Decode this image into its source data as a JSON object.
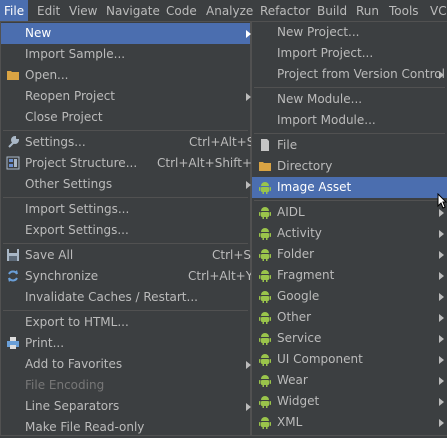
{
  "menubar": {
    "items": [
      "File",
      "Edit",
      "View",
      "Navigate",
      "Code",
      "Analyze",
      "Refactor",
      "Build",
      "Run",
      "Tools",
      "VCS"
    ],
    "active": "File"
  },
  "file_menu": {
    "items": [
      {
        "label": "New",
        "submenu": true,
        "selected": true
      },
      {
        "label": "Import Sample..."
      },
      {
        "label": "Open...",
        "icon": "folder-icon"
      },
      {
        "label": "Reopen Project",
        "submenu": true
      },
      {
        "label": "Close Project"
      },
      {
        "label": "Settings...",
        "shortcut": "Ctrl+Alt+S",
        "icon": "wrench-icon"
      },
      {
        "label": "Project Structure...",
        "shortcut": "Ctrl+Alt+Shift+S",
        "icon": "project-structure-icon"
      },
      {
        "label": "Other Settings",
        "submenu": true
      },
      {
        "label": "Import Settings..."
      },
      {
        "label": "Export Settings..."
      },
      {
        "label": "Save All",
        "shortcut": "Ctrl+S",
        "icon": "save-icon"
      },
      {
        "label": "Synchronize",
        "shortcut": "Ctrl+Alt+Y",
        "icon": "sync-icon"
      },
      {
        "label": "Invalidate Caches / Restart..."
      },
      {
        "label": "Export to HTML..."
      },
      {
        "label": "Print...",
        "icon": "print-icon"
      },
      {
        "label": "Add to Favorites",
        "submenu": true
      },
      {
        "label": "File Encoding",
        "disabled": true
      },
      {
        "label": "Line Separators",
        "submenu": true
      },
      {
        "label": "Make File Read-only"
      }
    ]
  },
  "new_menu": {
    "items": [
      {
        "label": "New Project..."
      },
      {
        "label": "Import Project..."
      },
      {
        "label": "Project from Version Control",
        "submenu": true
      },
      {
        "label": "New Module..."
      },
      {
        "label": "Import Module..."
      },
      {
        "label": "File",
        "icon": "file-icon"
      },
      {
        "label": "Directory",
        "icon": "folder-icon"
      },
      {
        "label": "Image Asset",
        "icon": "android-icon",
        "selected": true
      },
      {
        "label": "AIDL",
        "icon": "android-icon",
        "submenu": true
      },
      {
        "label": "Activity",
        "icon": "android-icon",
        "submenu": true
      },
      {
        "label": "Folder",
        "icon": "android-icon",
        "submenu": true
      },
      {
        "label": "Fragment",
        "icon": "android-icon",
        "submenu": true
      },
      {
        "label": "Google",
        "icon": "android-icon",
        "submenu": true
      },
      {
        "label": "Other",
        "icon": "android-icon",
        "submenu": true
      },
      {
        "label": "Service",
        "icon": "android-icon",
        "submenu": true
      },
      {
        "label": "UI Component",
        "icon": "android-icon",
        "submenu": true
      },
      {
        "label": "Wear",
        "icon": "android-icon",
        "submenu": true
      },
      {
        "label": "Widget",
        "icon": "android-icon",
        "submenu": true
      },
      {
        "label": "XML",
        "icon": "android-icon",
        "submenu": true
      }
    ]
  },
  "colors": {
    "background": "#3c3f41",
    "selection": "#4b6eaf",
    "text": "#bbbbbb",
    "android_green": "#9ac44b",
    "folder_yellow": "#d9a343"
  }
}
